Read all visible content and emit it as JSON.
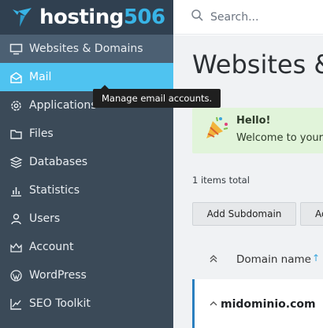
{
  "brand": {
    "name_main": "hosting",
    "name_accent": "506",
    "accent_color": "#38b4e6"
  },
  "search": {
    "placeholder": "Search..."
  },
  "sidebar": {
    "items": [
      {
        "label": "Websites & Domains",
        "icon": "monitor-icon",
        "state": "selected"
      },
      {
        "label": "Mail",
        "icon": "mail-icon",
        "state": "active"
      },
      {
        "label": "Applications",
        "icon": "gear-icon"
      },
      {
        "label": "Files",
        "icon": "folder-icon"
      },
      {
        "label": "Databases",
        "icon": "database-icon"
      },
      {
        "label": "Statistics",
        "icon": "bar-chart-icon"
      },
      {
        "label": "Users",
        "icon": "user-icon"
      },
      {
        "label": "Account",
        "icon": "account-icon"
      },
      {
        "label": "WordPress",
        "icon": "wordpress-icon"
      },
      {
        "label": "SEO Toolkit",
        "icon": "seo-chart-icon"
      }
    ]
  },
  "tooltip": {
    "text": "Manage email accounts."
  },
  "main": {
    "title": "Websites & Domains",
    "welcome": {
      "title": "Hello!",
      "message": "Welcome to your hosting panel"
    },
    "items_total": "1 items total",
    "buttons": {
      "add_subdomain": "Add Subdomain",
      "add_second": "Add Domain Alias"
    },
    "table": {
      "column_domain": "Domain name",
      "sort_indicator": "↑",
      "rows": [
        {
          "domain": "midominio.com"
        }
      ]
    }
  },
  "colors": {
    "sidebar_bg": "#3b4a58",
    "active_item": "#4fc3f0",
    "welcome_bg": "#e1f4da",
    "row_accent": "#2a7fbf"
  }
}
